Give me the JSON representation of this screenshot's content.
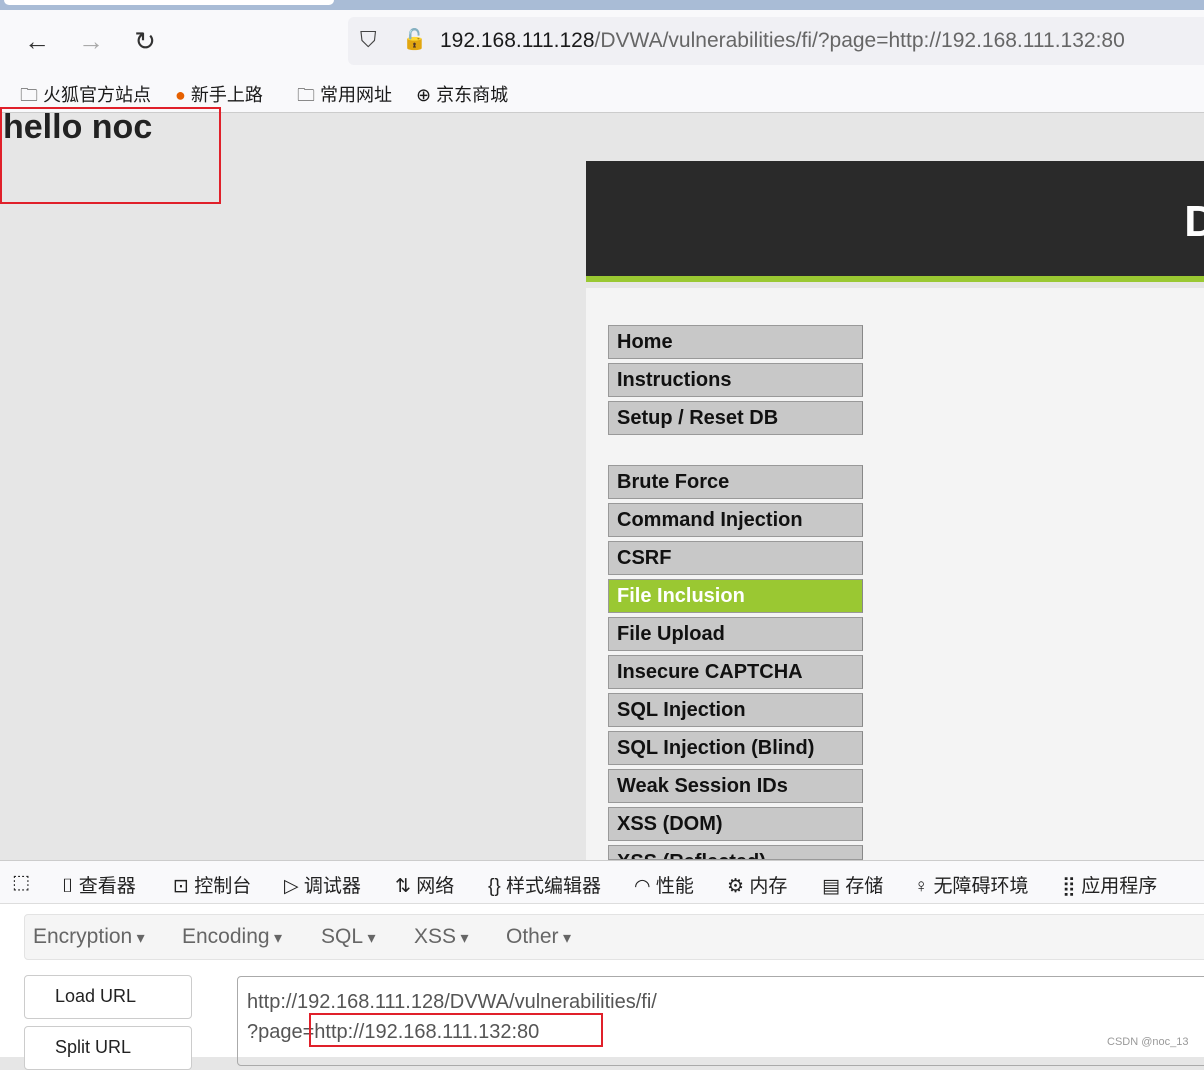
{
  "browser": {
    "url_host": "192.168.111.128",
    "url_path": "/DVWA/vulnerabilities/fi/?page=http://192.168.111.132:80",
    "bookmarks": [
      "火狐官方站点",
      "新手上路",
      "常用网址",
      "京东商城"
    ]
  },
  "page": {
    "injected_text": "hello noc",
    "logo_letter": "D",
    "menu": [
      "Home",
      "Instructions",
      "Setup / Reset DB",
      "Brute Force",
      "Command Injection",
      "CSRF",
      "File Inclusion",
      "File Upload",
      "Insecure CAPTCHA",
      "SQL Injection",
      "SQL Injection (Blind)",
      "Weak Session IDs",
      "XSS (DOM)",
      "XSS (Reflected)"
    ],
    "active_item": "File Inclusion",
    "accent": "#9ac832"
  },
  "devtools": {
    "tabs": [
      "查看器",
      "控制台",
      "调试器",
      "网络",
      "样式编辑器",
      "性能",
      "内存",
      "存储",
      "无障碍环境",
      "应用程序"
    ]
  },
  "hackbar": {
    "menus": [
      "Encryption",
      "Encoding",
      "SQL",
      "XSS",
      "Other"
    ],
    "load_url": "Load URL",
    "split_url": "Split URL",
    "url_line1": "http://192.168.111.128/DVWA/vulnerabilities/fi/",
    "url_line2": "?page=http://192.168.111.132:80"
  },
  "watermark": "CSDN @noc_13"
}
